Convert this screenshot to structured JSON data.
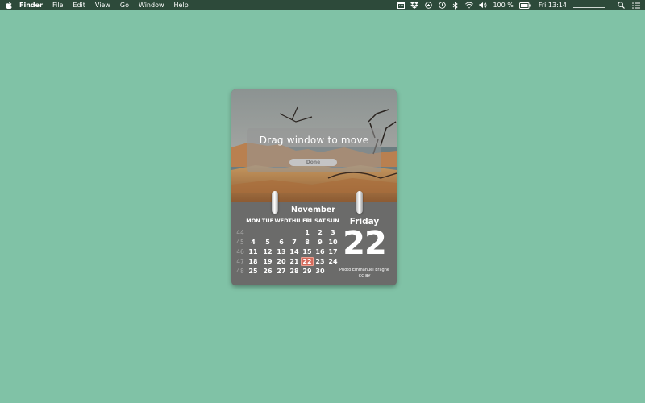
{
  "menubar": {
    "apple_icon": "apple-icon",
    "app_name": "Finder",
    "menus": [
      "File",
      "Edit",
      "View",
      "Go",
      "Window",
      "Help"
    ],
    "status_icons": [
      "calendar-icon",
      "dropbox-icon",
      "cloud-icon",
      "time-machine-icon",
      "bluetooth-icon",
      "wifi-icon",
      "volume-icon"
    ],
    "battery_percent": "100 %",
    "clock": "Fri 13:14",
    "search_icon": "search-icon",
    "notifications_icon": "list-icon"
  },
  "widget": {
    "overlay": {
      "title": "Drag window to move",
      "button": "Done"
    },
    "calendar": {
      "month": "November",
      "weekdays": [
        "MON",
        "TUE",
        "WED",
        "THU",
        "FRI",
        "SAT",
        "SUN"
      ],
      "weeks": [
        {
          "number": "44",
          "days": [
            "",
            "",
            "",
            "",
            "1",
            "2",
            "3"
          ]
        },
        {
          "number": "45",
          "days": [
            "4",
            "5",
            "6",
            "7",
            "8",
            "9",
            "10"
          ]
        },
        {
          "number": "46",
          "days": [
            "11",
            "12",
            "13",
            "14",
            "15",
            "16",
            "17"
          ]
        },
        {
          "number": "47",
          "days": [
            "18",
            "19",
            "20",
            "21",
            "22",
            "23",
            "24"
          ]
        },
        {
          "number": "48",
          "days": [
            "25",
            "26",
            "27",
            "28",
            "29",
            "30",
            ""
          ]
        }
      ],
      "today": "22",
      "today_weekday": "Friday",
      "highlight_color": "#d46a5c"
    },
    "photo_credit": [
      "Photo Emmanuel Eragne",
      "CC BY"
    ]
  },
  "colors": {
    "desktop": "#80c2a6",
    "menubar": "#2d4a3a",
    "widget_body": "#6b6b6a"
  }
}
